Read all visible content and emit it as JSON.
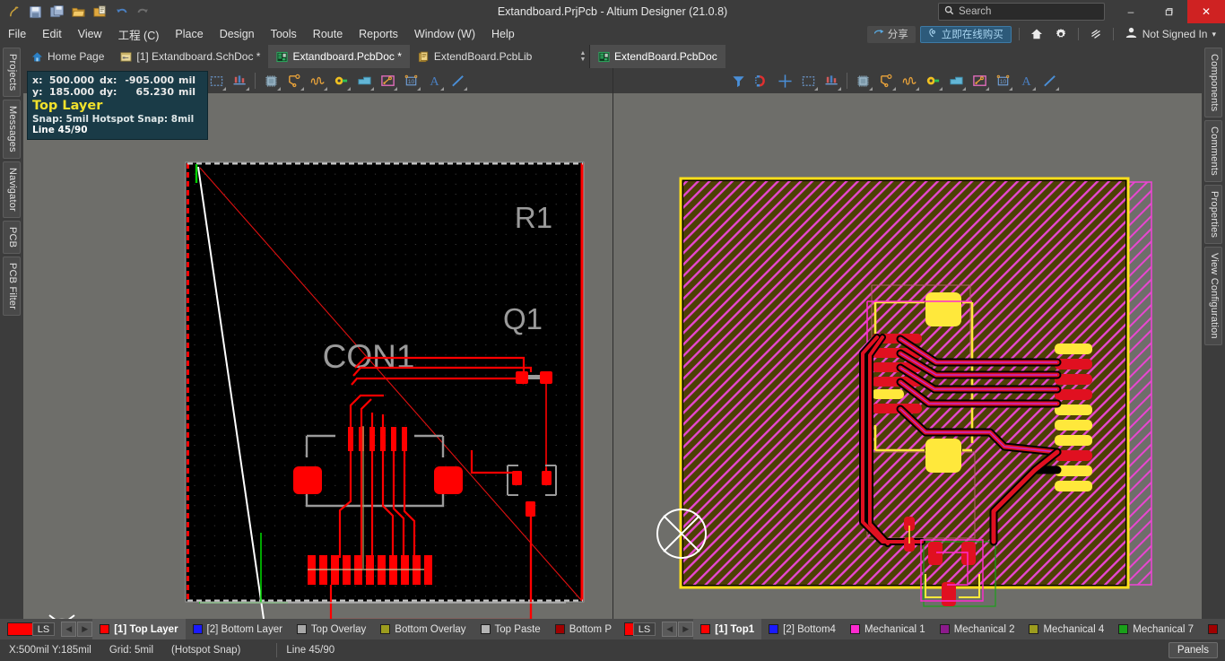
{
  "window": {
    "title": "Extandboard.PrjPcb - Altium Designer (21.0.8)",
    "minimize": "–",
    "restore": "❐",
    "close": "✕"
  },
  "quick_access": [
    {
      "name": "altium-logo-icon",
      "glyph": "∂"
    },
    {
      "name": "save-icon",
      "glyph": "ὋE"
    },
    {
      "name": "save-all-icon",
      "glyph": "὚B"
    },
    {
      "name": "open-icon",
      "glyph": "Ὄ2"
    },
    {
      "name": "open-project-icon",
      "glyph": "὜1"
    },
    {
      "name": "undo-icon",
      "glyph": "↶"
    },
    {
      "name": "redo-icon",
      "glyph": "↷"
    }
  ],
  "search": {
    "placeholder": "Search",
    "value": "",
    "icon": "search-icon"
  },
  "menu": [
    {
      "label": "File",
      "accel": "F"
    },
    {
      "label": "Edit",
      "accel": "E"
    },
    {
      "label": "View",
      "accel": "V"
    },
    {
      "label": "工程 (C)",
      "accel": "C"
    },
    {
      "label": "Place",
      "accel": "P"
    },
    {
      "label": "Design",
      "accel": "D"
    },
    {
      "label": "Tools",
      "accel": "T"
    },
    {
      "label": "Route",
      "accel": "u"
    },
    {
      "label": "Reports",
      "accel": "R"
    },
    {
      "label": "Window (W)",
      "accel": "W"
    },
    {
      "label": "Help",
      "accel": "H"
    }
  ],
  "menu_right": {
    "share_label": "分享",
    "buy_label": "立即在线购买",
    "home_icon": "home-icon",
    "settings_icon": "gear-icon",
    "license_icon": "license-icon",
    "account_icon": "account-icon",
    "account_label": "Not Signed In",
    "account_caret": "▾"
  },
  "left_dock": [
    {
      "label": "Projects"
    },
    {
      "label": "Messages"
    },
    {
      "label": "Navigator"
    },
    {
      "label": "PCB"
    },
    {
      "label": "PCB Filter"
    }
  ],
  "right_dock": [
    {
      "label": "Components"
    },
    {
      "label": "Comments"
    },
    {
      "label": "Properties"
    },
    {
      "label": "View Configuration"
    }
  ],
  "tabs_left": [
    {
      "label": "Home Page",
      "icon": "home-icon",
      "active": false
    },
    {
      "label": "[1] Extandboard.SchDoc *",
      "icon": "schematic-icon",
      "active": false
    },
    {
      "label": "Extandboard.PcbDoc *",
      "icon": "pcb-icon",
      "active": true
    },
    {
      "label": "ExtendBoard.PcbLib",
      "icon": "pcblib-icon",
      "active": false
    }
  ],
  "tabs_right": [
    {
      "label": "ExtendBoard.PcbDoc",
      "icon": "pcb-icon",
      "active": true
    }
  ],
  "toolbar_left": [
    {
      "name": "select-area-icon",
      "kind": "select-rect"
    },
    {
      "name": "component-place-icon",
      "kind": "comp-place"
    },
    {
      "sep": true
    },
    {
      "name": "place-component-icon",
      "kind": "chip"
    },
    {
      "name": "place-track-icon",
      "kind": "track"
    },
    {
      "name": "place-arc-icon",
      "kind": "arc"
    },
    {
      "name": "place-pad-icon",
      "kind": "pad"
    },
    {
      "name": "place-fill-icon",
      "kind": "fill"
    },
    {
      "name": "place-polygon-icon",
      "kind": "polygon"
    },
    {
      "name": "place-dimension-icon",
      "kind": "dimension"
    },
    {
      "name": "place-string-icon",
      "kind": "string"
    },
    {
      "name": "place-line-icon",
      "kind": "line"
    }
  ],
  "toolbar_right": [
    {
      "name": "filter-icon",
      "kind": "filter"
    },
    {
      "name": "magnet-icon",
      "kind": "magnet"
    },
    {
      "name": "crosshair-icon",
      "kind": "cross"
    },
    {
      "name": "select-area-icon",
      "kind": "select-rect"
    },
    {
      "name": "component-place-icon",
      "kind": "comp-place"
    },
    {
      "sep": true
    },
    {
      "name": "place-component-icon",
      "kind": "chip"
    },
    {
      "name": "place-track-icon",
      "kind": "track"
    },
    {
      "name": "place-arc-icon",
      "kind": "arc"
    },
    {
      "name": "place-pad-icon",
      "kind": "pad"
    },
    {
      "name": "place-fill-icon",
      "kind": "fill"
    },
    {
      "name": "place-polygon-icon",
      "kind": "polygon"
    },
    {
      "name": "place-dimension-icon",
      "kind": "dimension"
    },
    {
      "name": "place-string-icon",
      "kind": "string"
    },
    {
      "name": "place-line-icon",
      "kind": "line"
    }
  ],
  "hud": {
    "x_key": "x:",
    "x_value": "500.000",
    "dx_key": "dx:",
    "dx_value": "-905.000",
    "dx_unit": "mil",
    "y_key": "y:",
    "y_value": "185.000",
    "dy_key": "dy:",
    "dy_value": "65.230",
    "dy_unit": "mil",
    "layer": "Top Layer",
    "snap": "Snap: 5mil Hotspot Snap: 8mil",
    "line": "Line 45/90"
  },
  "pcb_left": {
    "designators": [
      "R1",
      "CON1",
      "Q1"
    ],
    "board_bg": "#000000",
    "trace_color": "#ff0000",
    "silk_color": "#9a9a9a",
    "keepout_color": "#ffffff",
    "mech_color": "#00d000"
  },
  "pcb_right": {
    "board_fill": "#4d4005",
    "hatch_color": "#e846d0",
    "outline_color": "#ffdf1a",
    "pad_yellow": "#ffe83b",
    "pad_red": "#e01020",
    "keepout_color": "#ffffff"
  },
  "layers_left": {
    "ls_color": "#ff0000",
    "ls_label": "LS",
    "prev_arrow": "◀",
    "next_arrow": "▶",
    "items": [
      {
        "label": "[1] Top Layer",
        "color": "#ff0000",
        "active": true
      },
      {
        "label": "[2] Bottom Layer",
        "color": "#1a1aff",
        "active": false
      },
      {
        "label": "Top Overlay",
        "color": "#a8a8a8",
        "active": false
      },
      {
        "label": "Bottom Overlay",
        "color": "#9c9c1e",
        "active": false
      },
      {
        "label": "Top Paste",
        "color": "#b5b5b5",
        "active": false
      },
      {
        "label": "Bottom P",
        "color": "#a00000",
        "active": false
      }
    ]
  },
  "layers_right": {
    "ls_color": "#ff0000",
    "ls_label": "LS",
    "prev_arrow": "◀",
    "next_arrow": "▶",
    "items": [
      {
        "label": "[1] Top1",
        "color": "#ff0000",
        "active": true
      },
      {
        "label": "[2] Bottom4",
        "color": "#1a1aff",
        "active": false
      },
      {
        "label": "Mechanical 1",
        "color": "#ff2ad0",
        "active": false
      },
      {
        "label": "Mechanical 2",
        "color": "#8c1a8c",
        "active": false
      },
      {
        "label": "Mechanical 4",
        "color": "#9c9c1e",
        "active": false
      },
      {
        "label": "Mechanical 7",
        "color": "#1aa01a",
        "active": false
      }
    ]
  },
  "status": {
    "coords": "X:500mil Y:185mil",
    "grid": "Grid: 5mil",
    "snap_mode": "(Hotspot Snap)",
    "line_mode": "Line 45/90",
    "panels_label": "Panels"
  }
}
